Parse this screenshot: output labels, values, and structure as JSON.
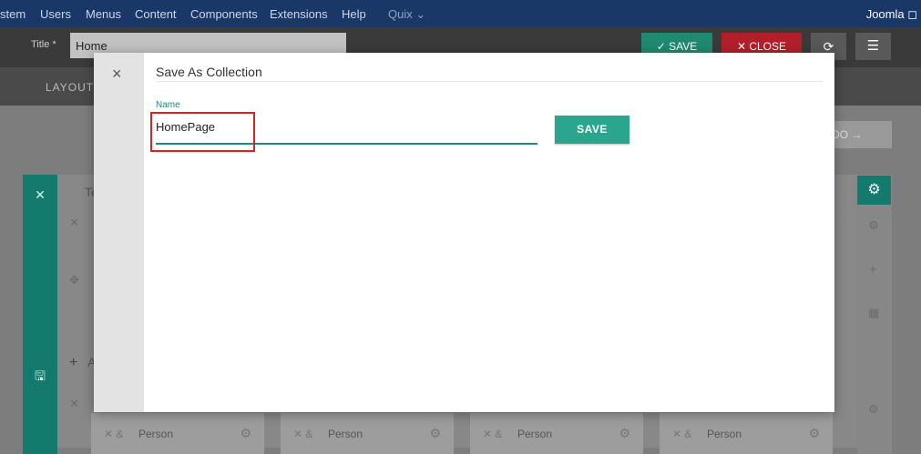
{
  "menubar": {
    "items": [
      "stem",
      "Users",
      "Menus",
      "Content",
      "Components",
      "Extensions",
      "Help",
      "Quix ⌄"
    ],
    "brand": "Joomla ◻"
  },
  "toolbar": {
    "title_label": "Title *",
    "title_value": "Home",
    "save_label": "✓ SAVE",
    "close_label": "✕ CLOSE",
    "refresh_icon": "⟳",
    "menu_icon": "☰"
  },
  "tabs": {
    "layout": "LAYOUT"
  },
  "builder": {
    "redo_label": "DO →",
    "cards": [
      "Person",
      "Person",
      "Person",
      "Person"
    ],
    "row_letters": [
      "Te",
      "A"
    ]
  },
  "modal": {
    "close_icon": "×",
    "title": "Save As Collection",
    "field_label": "Name",
    "field_value": "HomePage",
    "save_label": "SAVE"
  },
  "colors": {
    "accent": "#2aa68e",
    "highlight": "#e02020",
    "menubar": "#1a3867",
    "close": "#b21f2a"
  }
}
